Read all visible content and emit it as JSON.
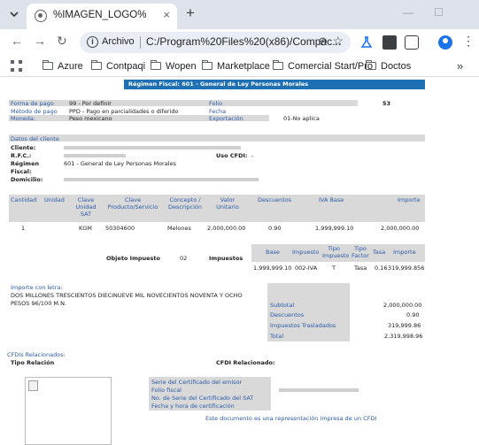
{
  "browser": {
    "tab_title": "%IMAGEN_LOGO%",
    "omnibox_scheme": "Archivo",
    "url": "C:/Program%20Files%20(x86)/Compac...",
    "bookmarks": [
      "Azure",
      "Contpaqi",
      "Wopen",
      "Marketplace",
      "Comercial Start/Pro",
      "Doctos"
    ]
  },
  "icons": {
    "tab_menu": "chevron-down",
    "tab_close": "×",
    "new_tab": "+",
    "minimize": "—",
    "maximize": "☐",
    "back": "←",
    "forward": "→",
    "reload": "↻",
    "info": "i",
    "zoom": "⊖",
    "star": "☆",
    "kebab": "⋮",
    "more_bookmarks": "»"
  },
  "invoice": {
    "regimen_header": "Régimen Fiscal: 601 - General de Ley Personas Morales",
    "forma_pago_label": "Forma de pago",
    "forma_pago_value": "99 - Por definir",
    "metodo_pago_label": "Método de pago",
    "metodo_pago_value": "PPD - Pago en parcialidades o diferido",
    "moneda_label": "Moneda:",
    "moneda_value": "Peso mexicano",
    "folio_label": "Folio",
    "folio_value": "53",
    "fecha_label": "Fecha",
    "exportacion_label": "Exportación",
    "exportacion_value": "01-No aplica",
    "cliente_section": "Datos del cliente",
    "cliente_label": "Cliente:",
    "rfc_label": "R.F.C.:",
    "regimen_label": "Régimen",
    "regimen_value": "601 - General de Ley Personas Morales",
    "fiscal_label": "Fiscal:",
    "domicilio_label": "Domicilio:",
    "uso_cfdi_label": "Uso CFDI:",
    "uso_cfdi_value": "-",
    "columns": [
      "Cantidad",
      "Unidad",
      "Clave Unidad SAT",
      "Clave Producto/Servicio",
      "Concepto / Descripción",
      "Valor Unitario",
      "Descuentos",
      "IVA Base",
      "Importe"
    ],
    "row": {
      "cantidad": "1",
      "clave_unidad": "KGM",
      "clave_prod": "50304600",
      "concepto": "Melones",
      "valor_unitario": "2,000,000.00",
      "descuentos": "0.90",
      "iva_base": "1,999,999.10",
      "importe": "2,000,000.00"
    },
    "objeto_impuesto_label": "Objeto Impuesto",
    "objeto_impuesto_value": "02",
    "impuestos_label": "Impuestos",
    "tax_columns": [
      "Base",
      "Impuesto",
      "Tipo Impuesto",
      "Tipo Factor",
      "Tasa",
      "Importe"
    ],
    "tax_row": {
      "base": "1,999,999.10",
      "impuesto": "002-IVA",
      "tipo": "T",
      "factor": "Tasa",
      "tasa": "0.16",
      "importe": "319,999.856"
    },
    "importe_letra_label": "Importe con letra:",
    "importe_letra_line1": "DOS MILLONES TRESCIENTOS DIECINUEVE MIL NOVECIENTOS NOVENTA Y OCHO",
    "importe_letra_line2": "PESOS 96/100 M.N.",
    "subtotal_label": "Subtotal",
    "subtotal_value": "2,000,000.00",
    "descuentos_label": "Descuentos",
    "descuentos_value": "0.90",
    "impuestos_tras_label": "Impuestos Trasladados",
    "impuestos_tras_value": "319,999.86",
    "total_label": "Total",
    "total_value": "2,319,998.96",
    "cfdis_label": "CFDIs Relacionados:",
    "tipo_relacion_label": "Tipo Relación",
    "cfdi_relacionado_label": "CFDI Relacionado:",
    "serie_emisor_label": "Serie del Certificado del emisor",
    "folio_fiscal_label": "Folio fiscal",
    "serie_sat_label": "No. de Serie del Certificado del SAT",
    "fecha_cert_label": "Fecha y hora de certificación",
    "footer_note": "Este documento es una representación impresa de un CFDI"
  }
}
